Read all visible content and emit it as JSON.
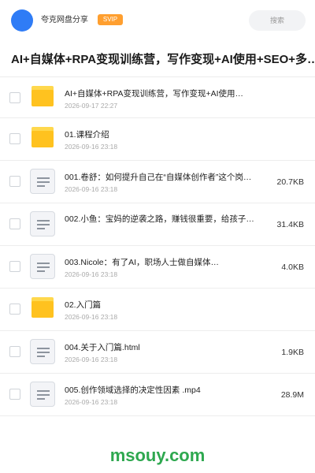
{
  "header": {
    "app_name": "夸克网盘分享",
    "badge": "SVIP",
    "search_placeholder": "搜索"
  },
  "page_title": "AI+自媒体+RPA变现训练营，写作变现+AI使用+SEO+多…",
  "items": [
    {
      "type": "folder",
      "name": "AI+自媒体+RPA变现训练营，写作变现+AI使用…",
      "date": "2026-09-17 22:27",
      "size": ""
    },
    {
      "type": "folder",
      "name": "01.课程介绍",
      "date": "2026-09-16 23:18",
      "size": ""
    },
    {
      "type": "file",
      "name": "001.卷舒：如何提升自己在“自媒体创作者”这个岗…",
      "date": "2026-09-16 23:18",
      "size": "20.7KB"
    },
    {
      "type": "file",
      "name": "002.小鱼：宝妈的逆袭之路，赚钱很重要，给孩子…",
      "date": "2026-09-16 23:18",
      "size": "31.4KB"
    },
    {
      "type": "file",
      "name": "003.Nicole：有了AI，职场人士做自媒体…",
      "date": "2026-09-16 23:18",
      "size": "4.0KB"
    },
    {
      "type": "folder",
      "name": "02.入门篇",
      "date": "2026-09-16 23:18",
      "size": ""
    },
    {
      "type": "file",
      "name": "004.关于入门篇.html",
      "date": "2026-09-16 23:18",
      "size": "1.9KB"
    },
    {
      "type": "file",
      "name": "005.创作领域选择的决定性因素 .mp4",
      "date": "2026-09-16 23:18",
      "size": "28.9M"
    }
  ],
  "watermark": "msouy.com",
  "colors": {
    "accent_blue": "#2f7cf6",
    "svip_orange": "#ff9f2f",
    "folder_yellow": "#ffc21f",
    "watermark_green": "#2ea84f"
  }
}
